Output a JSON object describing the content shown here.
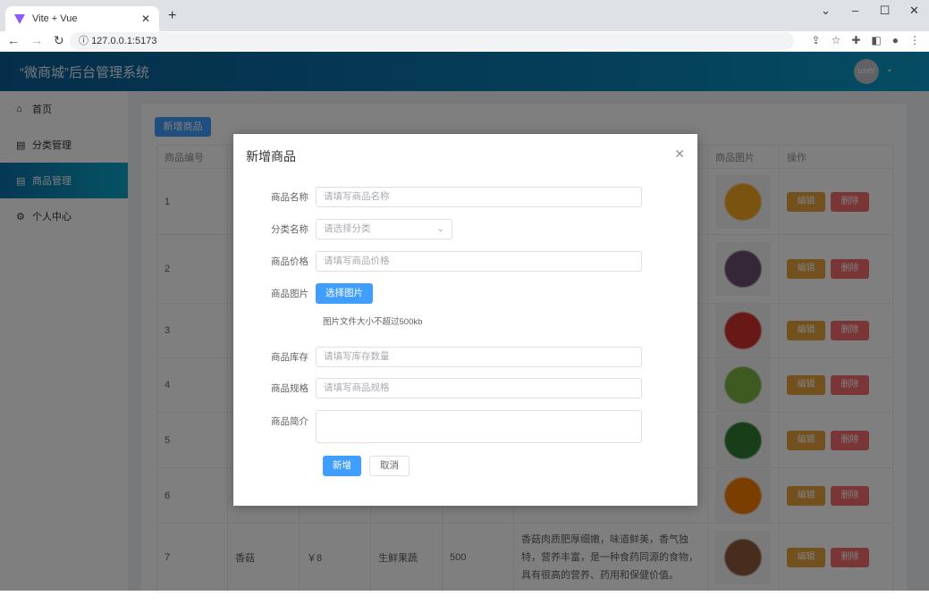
{
  "browser": {
    "tab_title": "Vite + Vue",
    "url": "127.0.0.1:5173"
  },
  "header": {
    "title": "“微商城”后台管理系统",
    "user": "user"
  },
  "sidebar": {
    "items": [
      {
        "label": "首页",
        "icon": "home-icon"
      },
      {
        "label": "分类管理",
        "icon": "clipboard-icon"
      },
      {
        "label": "商品管理",
        "icon": "clipboard-icon",
        "active": true
      },
      {
        "label": "个人中心",
        "icon": "gear-icon"
      }
    ]
  },
  "main": {
    "add_button": "新增商品",
    "table": {
      "headers": {
        "id": "商品编号",
        "image": "商品图片",
        "actions": "操作"
      },
      "edit_label": "编辑",
      "delete_label": "删除",
      "rows": [
        {
          "id": "1",
          "img_color": "#f5a623"
        },
        {
          "id": "2",
          "img_color": "#6b4e71"
        },
        {
          "id": "3",
          "img_color": "#d0312d"
        },
        {
          "id": "4",
          "img_color": "#7cb342"
        },
        {
          "id": "5",
          "img_color": "#2e7d32"
        },
        {
          "id": "6",
          "img_color": "#f57c00"
        },
        {
          "id": "7",
          "name": "香菇",
          "price": "￥8",
          "category": "生鲜果蔬",
          "stock": "500",
          "desc": "香菇肉质肥厚细嫩，味道鲜美，香气独特，营养丰富，是一种食药同源的食物，具有很高的营养、药用和保健价值。",
          "img_color": "#8d5a3b"
        }
      ]
    }
  },
  "dialog": {
    "title": "新增商品",
    "fields": {
      "name": {
        "label": "商品名称",
        "placeholder": "请填写商品名称"
      },
      "category": {
        "label": "分类名称",
        "placeholder": "请选择分类"
      },
      "price": {
        "label": "商品价格",
        "placeholder": "请填写商品价格"
      },
      "image": {
        "label": "商品图片",
        "button": "选择图片",
        "tip": "图片文件大小不超过500kb"
      },
      "stock": {
        "label": "商品库存",
        "placeholder": "请填写库存数量"
      },
      "spec": {
        "label": "商品规格",
        "placeholder": "请填写商品规格"
      },
      "intro": {
        "label": "商品简介",
        "placeholder": ""
      }
    },
    "submit": "新增",
    "cancel": "取消"
  }
}
